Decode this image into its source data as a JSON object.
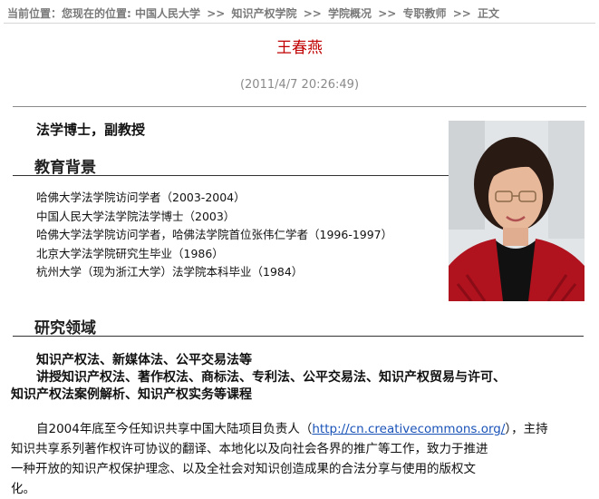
{
  "breadcrumb": {
    "prefix": "当前位置：您现在的位置:",
    "items": [
      "中国人民大学",
      "知识产权学院",
      "学院概况",
      "专职教师",
      "正文"
    ],
    "separator": ">>"
  },
  "article": {
    "title": "王春燕",
    "date": "(2011/4/7 20:26:49)"
  },
  "profile": {
    "degree": "法学博士，副教授",
    "education_heading": "教育背景",
    "education": [
      "哈佛大学法学院访问学者（2003-2004）",
      "中国人民大学法学院法学博士（2003）",
      "哈佛大学法学院访问学者，哈佛法学院首位张伟仁学者（1996-1997）",
      "北京大学法学院研究生毕业（1986）",
      "杭州大学（现为浙江大学）法学院本科毕业（1984）"
    ],
    "research_heading": "研究领域",
    "research_fields": "知识产权法、新媒体法、公平交易法等",
    "courses_line1": "讲授知识产权法、著作权法、商标法、专利法、公平交易法、知识产权贸易与许可、",
    "courses_line2": "知识产权法案例解析、知识产权实务等课程",
    "intro_before_link": "自2004年底至今任知识共享中国大陆项目负责人（",
    "intro_link": "http://cn.creativecommons.org/",
    "intro_after_link": "），主持",
    "intro_line2": "知识共享系列著作权许可协议的翻译、本地化以及向社会各界的推广等工作，致力于推进",
    "intro_line3": "一种开放的知识产权保护理念、以及全社会对知识创造成果的合法分享与使用的版权文",
    "intro_line4": "化。"
  },
  "colors": {
    "title": "#c00000",
    "link": "#1a53b8",
    "muted": "#7a7a7a"
  }
}
